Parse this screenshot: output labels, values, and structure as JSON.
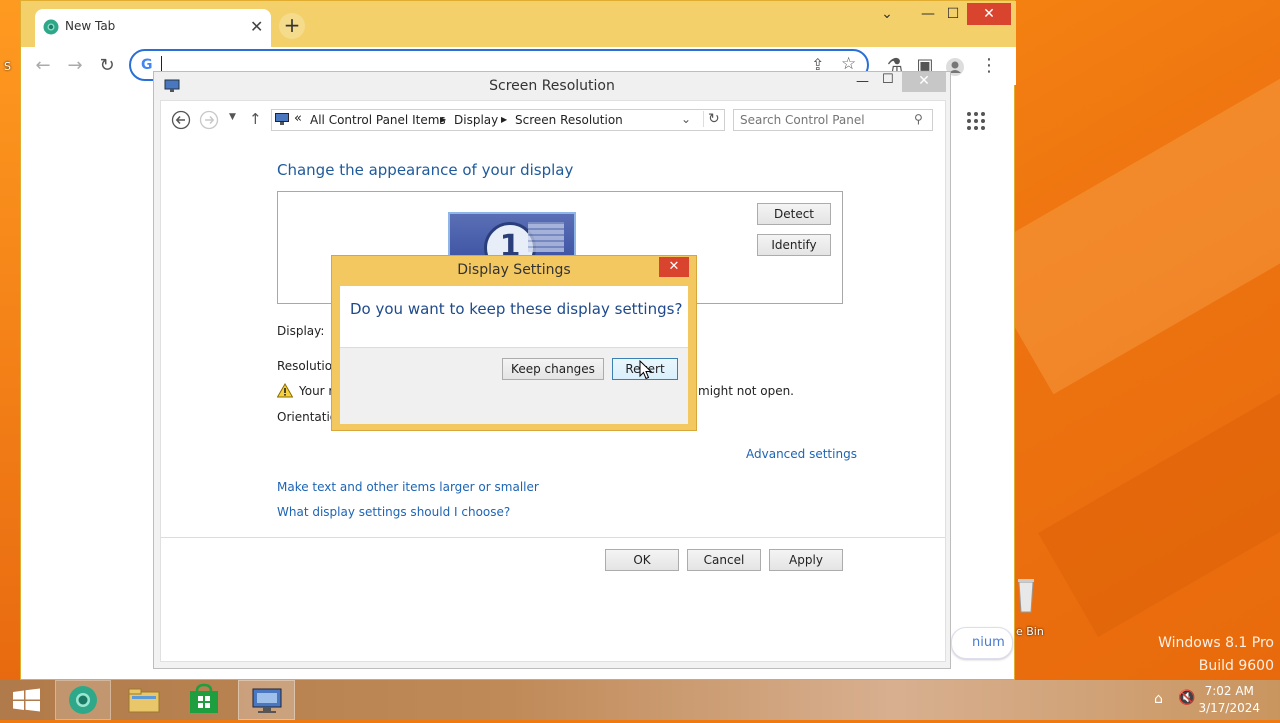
{
  "browser": {
    "tab_title": "New Tab",
    "tab_close": "✕",
    "new_tab": "+",
    "omnibox_value": "",
    "controls": {
      "chevron": "⌄",
      "minimize": "—",
      "maximize": "☐",
      "close": "✕"
    }
  },
  "control_panel": {
    "title": "Screen Resolution",
    "breadcrumb": [
      "All Control Panel Items",
      "Display",
      "Screen Resolution"
    ],
    "search_placeholder": "Search Control Panel",
    "heading": "Change the appearance of your display",
    "detect_label": "Detect",
    "identify_label": "Identify",
    "monitor_number": "1",
    "display_label": "Display:",
    "resolution_label": "Resolution",
    "warning_prefix": "Your r",
    "warning_suffix": "might not open.",
    "orientation_label": "Orientation",
    "advanced_link": "Advanced settings",
    "text_size_link": "Make text and other items larger or smaller",
    "help_link": "What display settings should I choose?",
    "ok_label": "OK",
    "cancel_label": "Cancel",
    "apply_label": "Apply"
  },
  "dialog": {
    "title": "Display Settings",
    "question": "Do you want to keep these display settings?",
    "keep_label": "Keep changes",
    "revert_label": "Revert"
  },
  "desktop": {
    "recycle_bin_label": "e Bin",
    "left_edge_label": "S",
    "premium_label": "nium",
    "os_edition": "Windows 8.1 Pro",
    "os_build": "Build 9600"
  },
  "taskbar": {
    "time": "7:02 AM",
    "date": "3/17/2024"
  },
  "colors": {
    "desktop_orange": "#f07a10",
    "dialog_frame": "#f4c860",
    "link_blue": "#1e64b4",
    "close_red": "#d9442f"
  }
}
